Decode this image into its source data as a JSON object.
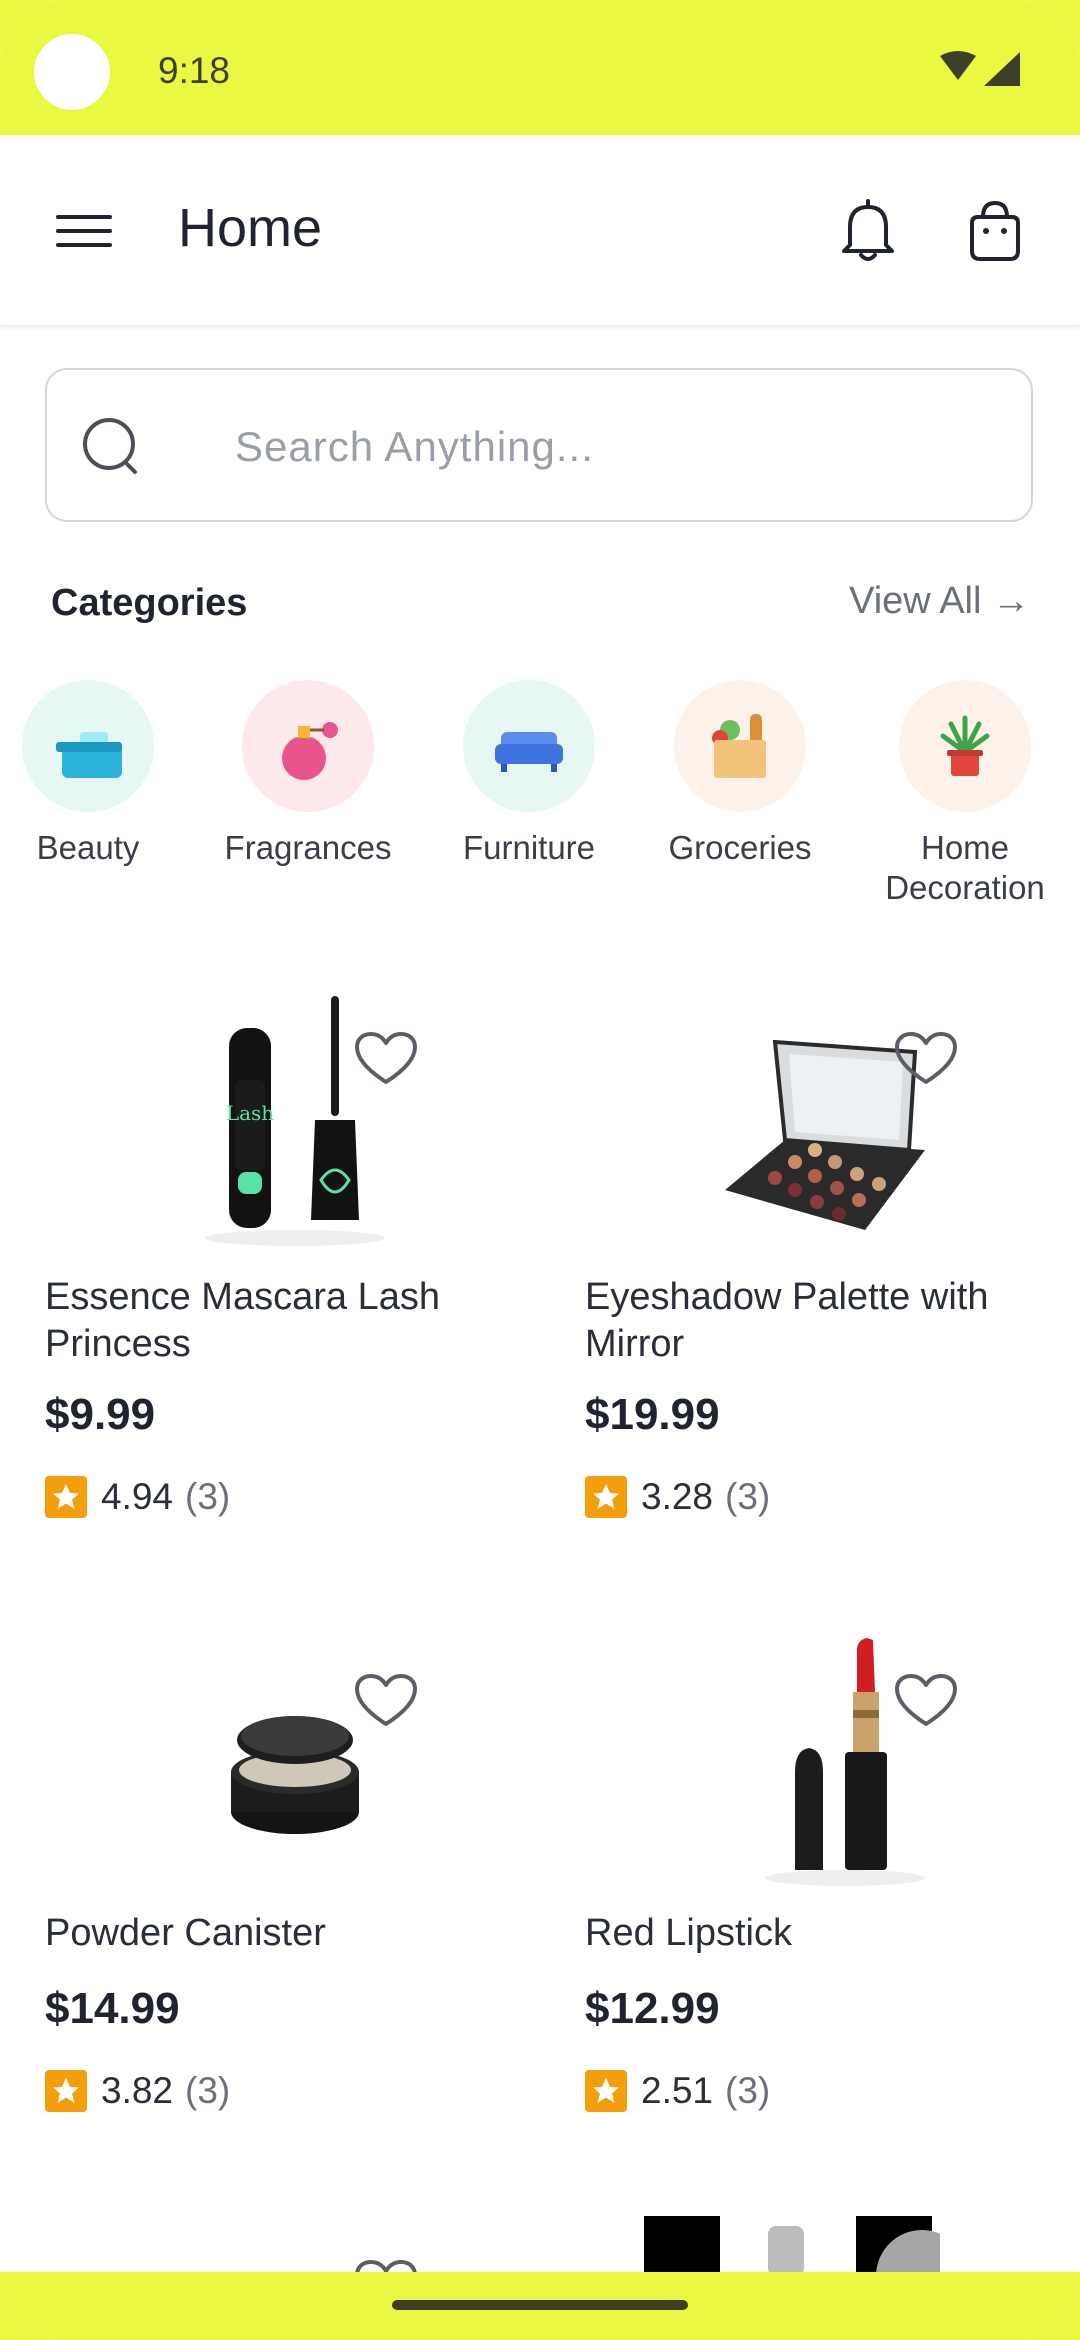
{
  "status": {
    "time": "9:18"
  },
  "appbar": {
    "title": "Home"
  },
  "search": {
    "placeholder": "Search Anything..."
  },
  "categories": {
    "heading": "Categories",
    "view_all": "View All →",
    "items": [
      {
        "label": "Beauty",
        "icon": "beauty-icon",
        "bg": "#e7f7f3"
      },
      {
        "label": "Fragrances",
        "icon": "perfume-icon",
        "bg": "#fde8ec"
      },
      {
        "label": "Furniture",
        "icon": "sofa-icon",
        "bg": "#e7f7f3"
      },
      {
        "label": "Groceries",
        "icon": "grocery-bag-icon",
        "bg": "#fdf2e9"
      },
      {
        "label": "Home Decoration",
        "icon": "plant-icon",
        "bg": "#fdf2e9"
      }
    ]
  },
  "products": [
    {
      "name": "Essence Mascara Lash Princess",
      "price": "$9.99",
      "rating": "4.94",
      "count": "(3)"
    },
    {
      "name": "Eyeshadow Palette with Mirror",
      "price": "$19.99",
      "rating": "3.28",
      "count": "(3)"
    },
    {
      "name": "Powder Canister",
      "price": "$14.99",
      "rating": "3.82",
      "count": "(3)"
    },
    {
      "name": "Red Lipstick",
      "price": "$12.99",
      "rating": "2.51",
      "count": "(3)"
    }
  ],
  "colors": {
    "accent": "#ebf841",
    "star": "#f59e0b",
    "text": "#1f2430"
  }
}
